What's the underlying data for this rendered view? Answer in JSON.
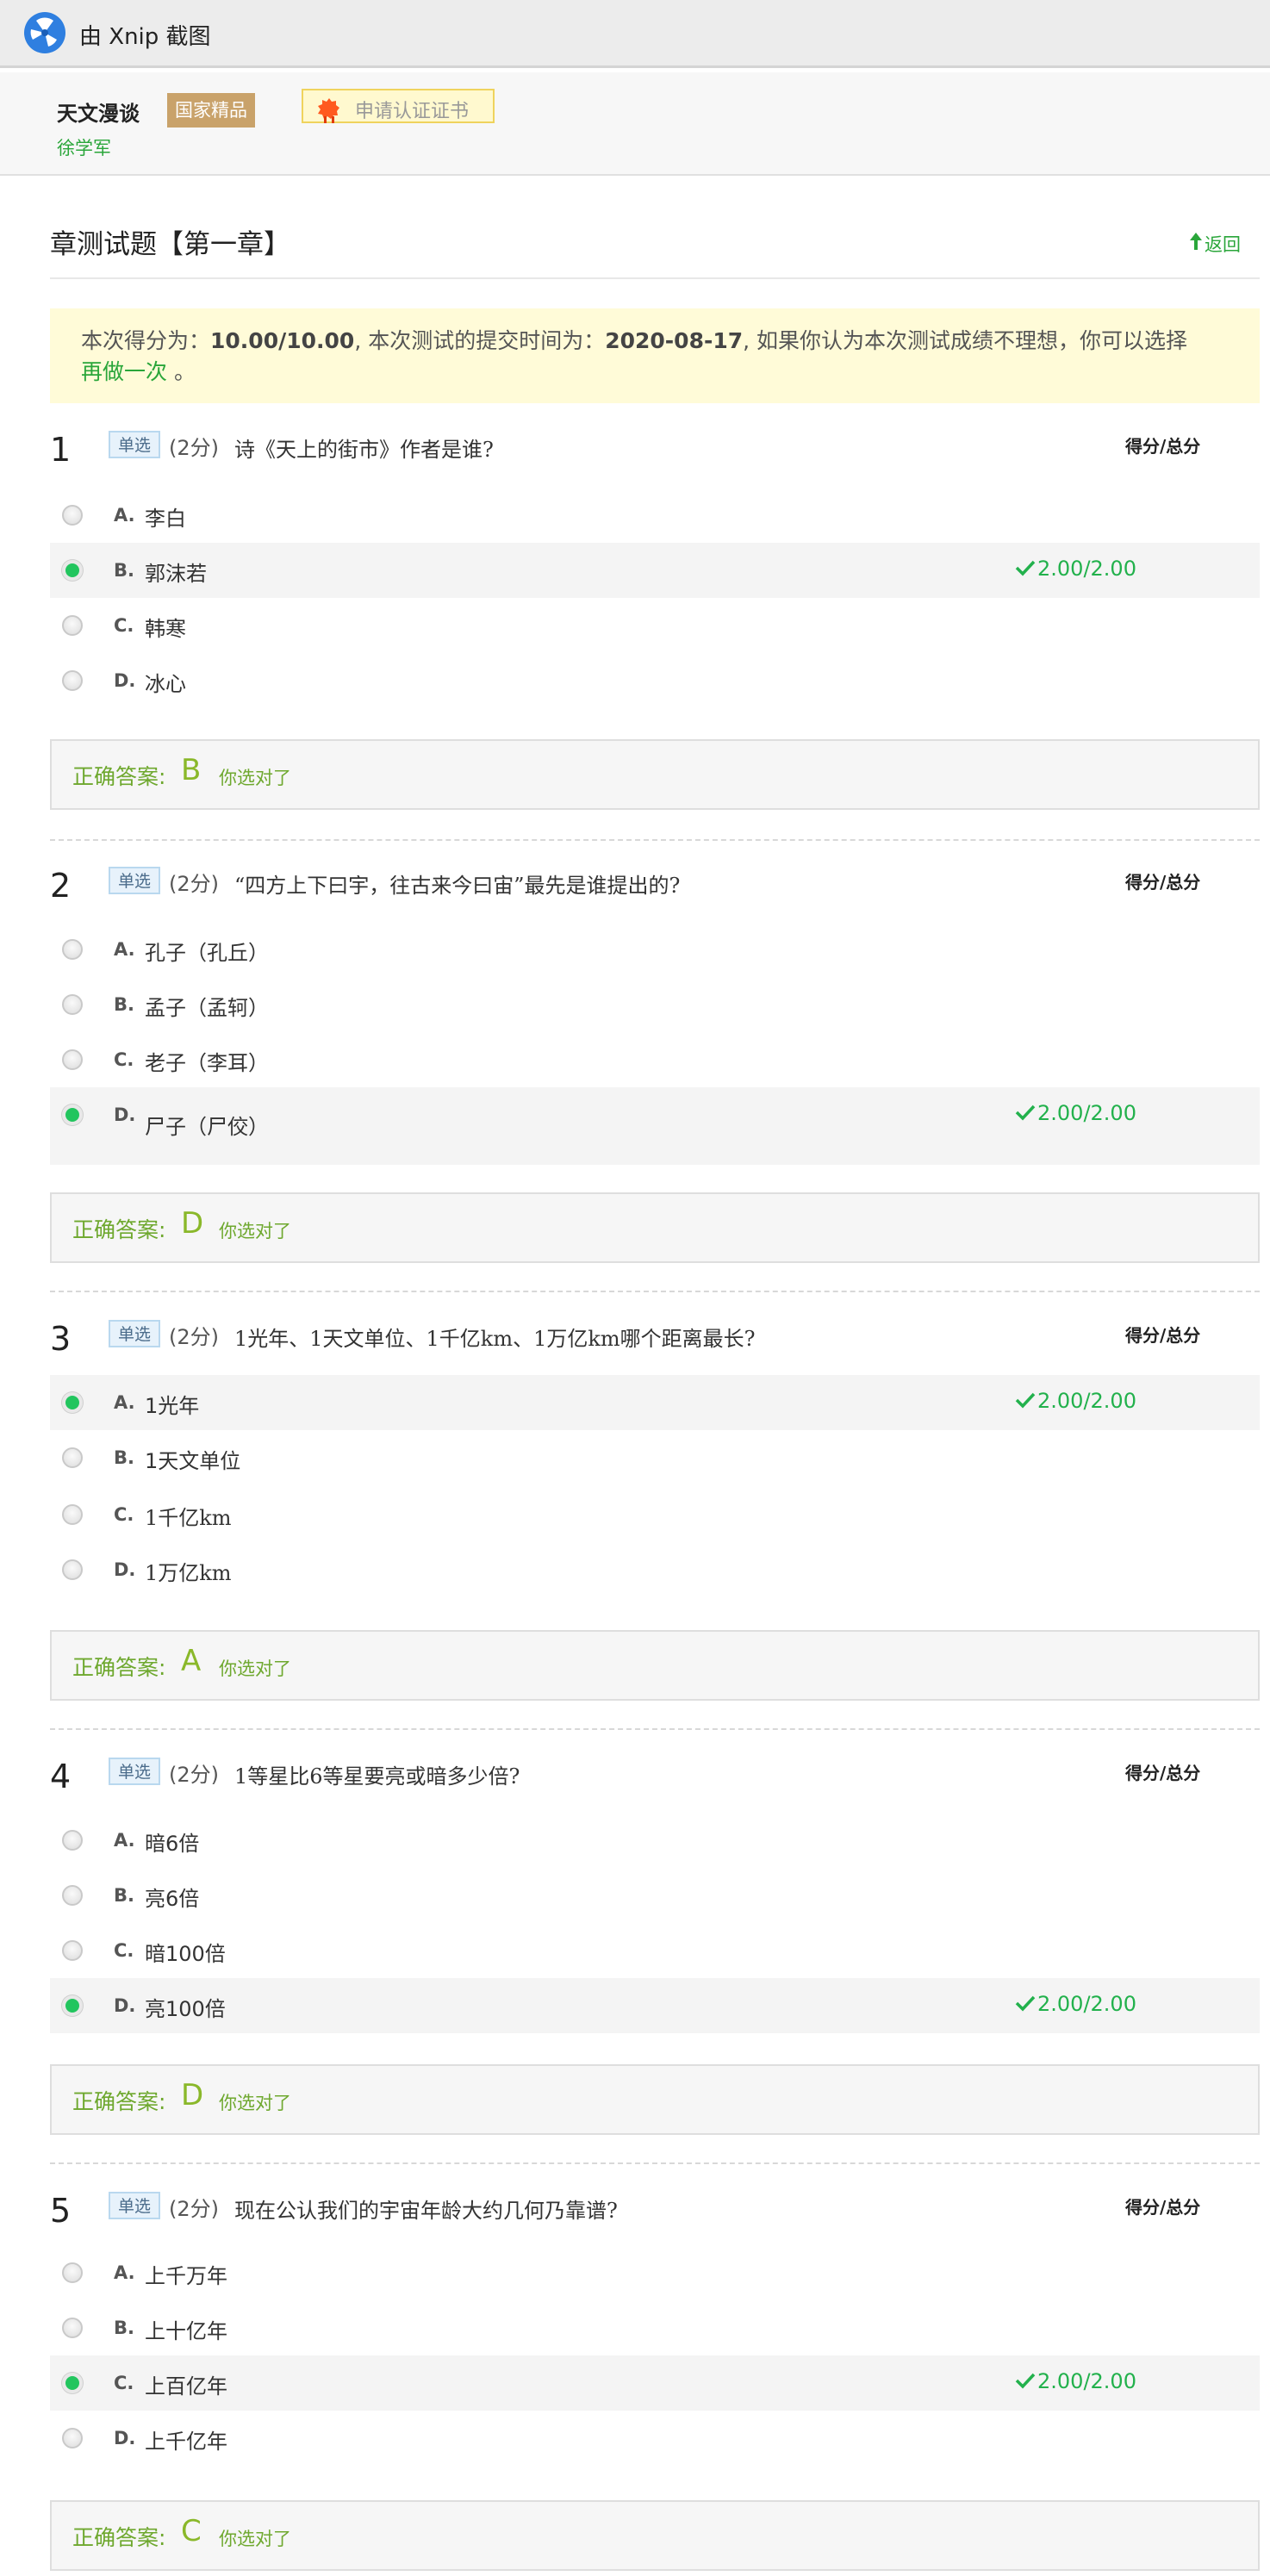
{
  "capture_bar": {
    "title": "由 Xnip 截图",
    "logo_icon": "xnip-logo-icon"
  },
  "course": {
    "name": "天文漫谈",
    "badge": "国家精品",
    "certificate_button": "申请认证证书",
    "teacher": "徐学军"
  },
  "page": {
    "title": "章测试题【第一章】",
    "back_label": "返回"
  },
  "result_banner": {
    "prefix": "本次得分为：",
    "score": "10.00/10.00",
    "middle": ", 本次测试的提交时间为：",
    "submit_time": "2020-08-17",
    "suffix": ", 如果你认为本次测试成绩不理想，你可以选择",
    "redo_label": "再做一次",
    "end": "。"
  },
  "colors": {
    "accent_green": "#22b14c",
    "answer_green": "#6ea82e",
    "badge_gold": "#c9a26a",
    "banner_bg": "#fffbd8"
  },
  "questions": [
    {
      "number": "1",
      "type": "单选",
      "points": "(2分)",
      "text": "诗《天上的街市》作者是谁?",
      "score_header": "得分/总分",
      "options": [
        {
          "letter": "A.",
          "text": "李白",
          "selected": false,
          "score": ""
        },
        {
          "letter": "B.",
          "text": "郭沫若",
          "selected": true,
          "score": "2.00/2.00"
        },
        {
          "letter": "C.",
          "text": "韩寒",
          "selected": false,
          "score": ""
        },
        {
          "letter": "D.",
          "text": "冰心",
          "selected": false,
          "score": ""
        }
      ],
      "answer_label": "正确答案:",
      "answer": "B",
      "verdict": "你选对了"
    },
    {
      "number": "2",
      "type": "单选",
      "points": "(2分)",
      "text": "“四方上下曰宇，往古来今曰宙”最先是谁提出的?",
      "score_header": "得分/总分",
      "options": [
        {
          "letter": "A.",
          "text": "孔子（孔丘）",
          "selected": false,
          "score": ""
        },
        {
          "letter": "B.",
          "text": "孟子（孟轲）",
          "selected": false,
          "score": ""
        },
        {
          "letter": "C.",
          "text": "老子（李耳）",
          "selected": false,
          "score": ""
        },
        {
          "letter": "D.",
          "text": "尸子（尸佼）",
          "selected": true,
          "score": "2.00/2.00"
        }
      ],
      "answer_label": "正确答案:",
      "answer": "D",
      "verdict": "你选对了"
    },
    {
      "number": "3",
      "type": "单选",
      "points": "(2分)",
      "text": "1光年、1天文单位、1千亿km、1万亿km哪个距离最长?",
      "score_header": "得分/总分",
      "options": [
        {
          "letter": "A.",
          "text": "1光年",
          "selected": true,
          "score": "2.00/2.00"
        },
        {
          "letter": "B.",
          "text": "1天文单位",
          "selected": false,
          "score": ""
        },
        {
          "letter": "C.",
          "text": "1千亿km",
          "selected": false,
          "score": ""
        },
        {
          "letter": "D.",
          "text": "1万亿km",
          "selected": false,
          "score": ""
        }
      ],
      "answer_label": "正确答案:",
      "answer": "A",
      "verdict": "你选对了"
    },
    {
      "number": "4",
      "type": "单选",
      "points": "(2分)",
      "text": "1等星比6等星要亮或暗多少倍?",
      "score_header": "得分/总分",
      "options": [
        {
          "letter": "A.",
          "text": "暗6倍",
          "selected": false,
          "score": ""
        },
        {
          "letter": "B.",
          "text": "亮6倍",
          "selected": false,
          "score": ""
        },
        {
          "letter": "C.",
          "text": "暗100倍",
          "selected": false,
          "score": ""
        },
        {
          "letter": "D.",
          "text": "亮100倍",
          "selected": true,
          "score": "2.00/2.00"
        }
      ],
      "answer_label": "正确答案:",
      "answer": "D",
      "verdict": "你选对了"
    },
    {
      "number": "5",
      "type": "单选",
      "points": "(2分)",
      "text": "现在公认我们的宇宙年龄大约几何乃靠谱?",
      "score_header": "得分/总分",
      "options": [
        {
          "letter": "A.",
          "text": "上千万年",
          "selected": false,
          "score": ""
        },
        {
          "letter": "B.",
          "text": "上十亿年",
          "selected": false,
          "score": ""
        },
        {
          "letter": "C.",
          "text": "上百亿年",
          "selected": true,
          "score": "2.00/2.00"
        },
        {
          "letter": "D.",
          "text": "上千亿年",
          "selected": false,
          "score": ""
        }
      ],
      "answer_label": "正确答案:",
      "answer": "C",
      "verdict": "你选对了"
    }
  ]
}
